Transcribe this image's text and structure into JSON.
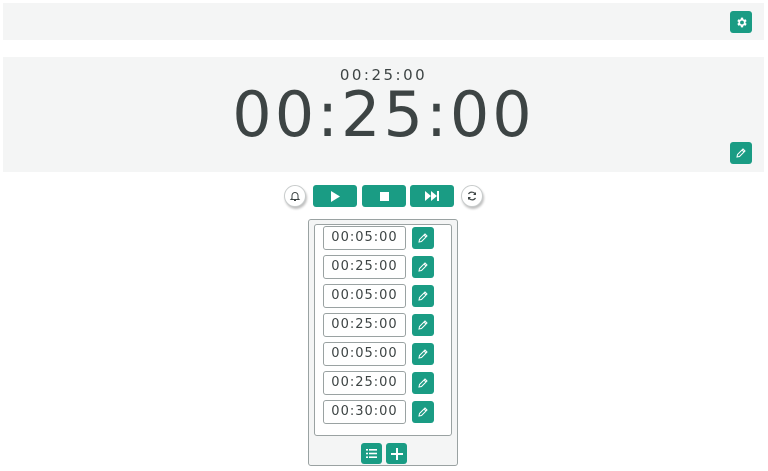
{
  "header": {
    "settings_icon": "gear-icon"
  },
  "timer": {
    "small_display": "00:25:00",
    "large_display": "00:25:00",
    "edit_icon": "pencil-icon"
  },
  "controls": {
    "bell_icon": "bell-icon",
    "play_icon": "play-icon",
    "stop_icon": "stop-icon",
    "skip_icon": "skip-forward-icon",
    "reset_icon": "refresh-icon"
  },
  "intervals": [
    {
      "time": "00:05:00"
    },
    {
      "time": "00:25:00"
    },
    {
      "time": "00:05:00"
    },
    {
      "time": "00:25:00"
    },
    {
      "time": "00:05:00"
    },
    {
      "time": "00:25:00"
    },
    {
      "time": "00:30:00"
    }
  ],
  "list_footer": {
    "list_icon": "list-icon",
    "add_icon": "plus-icon"
  },
  "colors": {
    "accent": "#1a9c84",
    "panel_bg": "#f4f5f5",
    "text": "#3d4444",
    "border": "#9aa2a2"
  }
}
